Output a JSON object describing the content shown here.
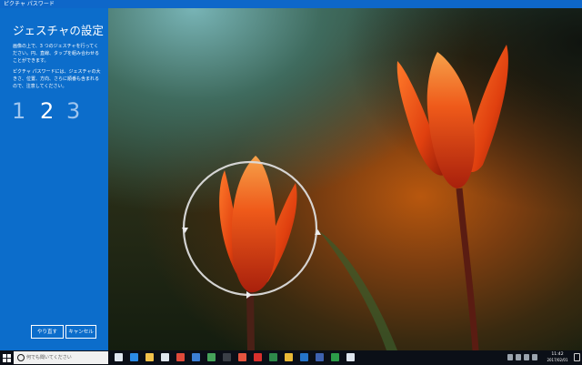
{
  "window": {
    "title": "ピクチャ パスワード"
  },
  "panel": {
    "heading": "ジェスチャの設定",
    "instructions": "画像の上で、3 つのジェスチャを行ってください。円、直線、タップを組み合わせることができます。",
    "info": "ピクチャ パスワードには、ジェスチャの大きさ、位置、方向、さらに順番も含まれるので、注意してください。",
    "steps": [
      "1",
      "2",
      "3"
    ],
    "active_step": 2,
    "buttons": {
      "redo": "やり直す",
      "cancel": "キャンセル"
    }
  },
  "taskbar": {
    "search_placeholder": "何でも聞いてください",
    "clock_time": "11:42",
    "clock_date": "2017/02/01",
    "pinned_apps": [
      {
        "name": "task-view",
        "color": "#dfe6ee"
      },
      {
        "name": "edge",
        "color": "#2b8be6"
      },
      {
        "name": "explorer",
        "color": "#f2c14b"
      },
      {
        "name": "store",
        "color": "#dfe6ee"
      },
      {
        "name": "photos",
        "color": "#e04a3a"
      },
      {
        "name": "mail",
        "color": "#3c7fd6"
      },
      {
        "name": "maps",
        "color": "#46a35a"
      },
      {
        "name": "groove",
        "color": "#3a3f46"
      },
      {
        "name": "chrome",
        "color": "#e5553f"
      },
      {
        "name": "acrobat",
        "color": "#d9302c"
      },
      {
        "name": "excel",
        "color": "#2e8a4a"
      },
      {
        "name": "chrome-2",
        "color": "#e9b936"
      },
      {
        "name": "outlook",
        "color": "#2574c9"
      },
      {
        "name": "word",
        "color": "#3e62b0"
      },
      {
        "name": "console",
        "color": "#2c9c49"
      },
      {
        "name": "settings",
        "color": "#dfe6ee"
      }
    ]
  }
}
